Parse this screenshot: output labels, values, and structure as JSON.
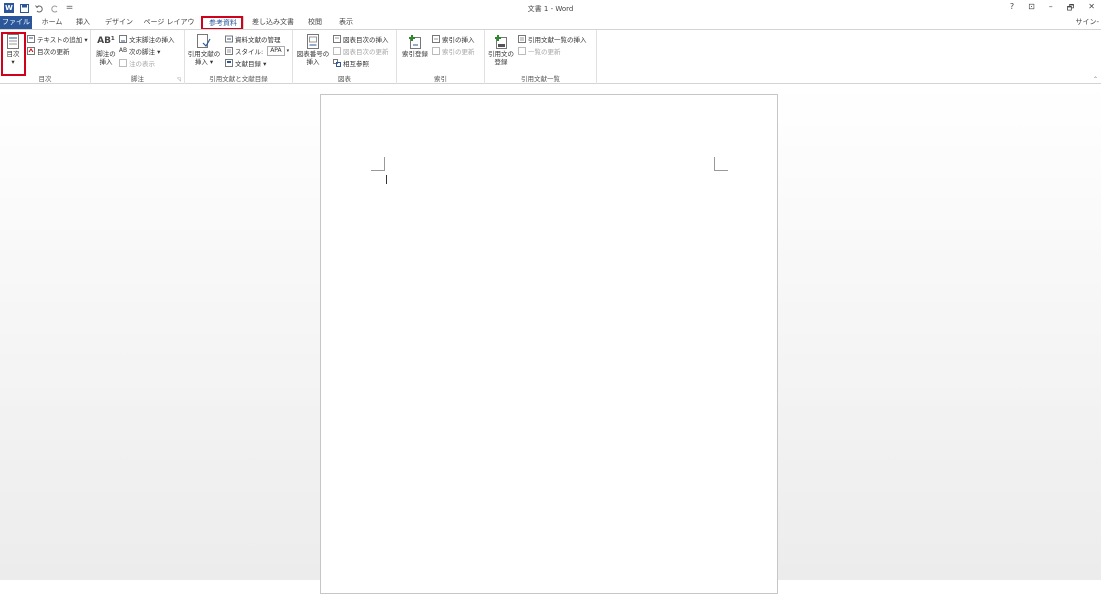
{
  "app": {
    "title": "文書 1 - Word",
    "logo": "W",
    "signin": "サイン-",
    "window_controls": [
      "?",
      "⊡",
      "–",
      "🗗",
      "✕"
    ]
  },
  "qat": {
    "save_icon": "save-icon",
    "undo_icon": "undo-icon",
    "redo_icon": "redo-icon",
    "customize": "="
  },
  "tabs": [
    {
      "label": "ファイル",
      "key": "file"
    },
    {
      "label": "ホーム",
      "key": "home"
    },
    {
      "label": "挿入",
      "key": "insert"
    },
    {
      "label": "デザイン",
      "key": "design"
    },
    {
      "label": "ページ レイアウト",
      "key": "layout"
    },
    {
      "label": "参考資料",
      "key": "references"
    },
    {
      "label": "差し込み文書",
      "key": "mailings"
    },
    {
      "label": "校閲",
      "key": "review"
    },
    {
      "label": "表示",
      "key": "view"
    }
  ],
  "ribbon": {
    "toc": {
      "label": "目次",
      "big": "目次",
      "add_text": "テキストの追加 ▾",
      "update": "目次の更新"
    },
    "footnotes": {
      "label": "脚注",
      "insert_footnote_l1": "脚注の",
      "insert_footnote_l2": "挿入",
      "insert_endnote": "文末脚注の挿入",
      "next_footnote": "次の脚注 ▾",
      "show_notes": "注の表示",
      "ab_icon": "AB¹"
    },
    "citations": {
      "label": "引用文献と文献目録",
      "insert_citation_l1": "引用文献の",
      "insert_citation_l2": "挿入 ▾",
      "manage_sources": "資料文献の管理",
      "style_label": "スタイル:",
      "style_value": "APA",
      "bibliography": "文献目録 ▾"
    },
    "captions": {
      "label": "図表",
      "insert_caption_l1": "図表番号の",
      "insert_caption_l2": "挿入",
      "insert_table_of_figures": "図表目次の挿入",
      "update_table": "図表目次の更新",
      "cross_reference": "相互参照"
    },
    "index": {
      "label": "索引",
      "mark_entry": "索引登録",
      "insert_index": "索引の挿入",
      "update_index": "索引の更新"
    },
    "authorities": {
      "label": "引用文献一覧",
      "mark_citation_l1": "引用文の",
      "mark_citation_l2": "登録",
      "insert_table": "引用文献一覧の挿入",
      "update_table": "一覧の更新"
    }
  },
  "colors": {
    "accent": "#2b579a",
    "highlight": "#d0021b"
  }
}
